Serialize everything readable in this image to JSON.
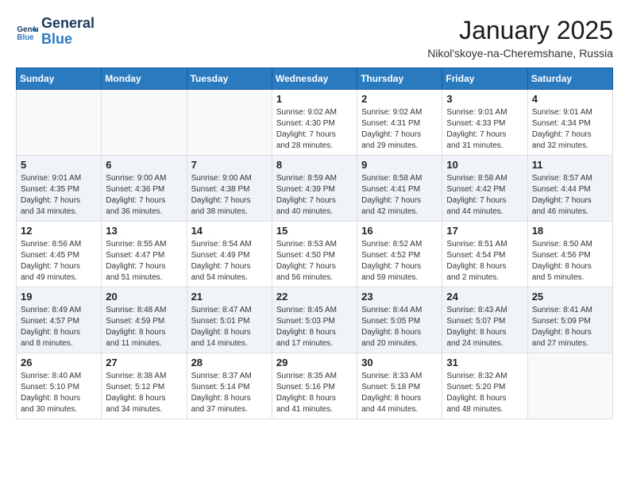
{
  "header": {
    "logo_line1": "General",
    "logo_line2": "Blue",
    "month_title": "January 2025",
    "location": "Nikol'skoye-na-Cheremshane, Russia"
  },
  "weekdays": [
    "Sunday",
    "Monday",
    "Tuesday",
    "Wednesday",
    "Thursday",
    "Friday",
    "Saturday"
  ],
  "weeks": [
    [
      {
        "day": "",
        "text": ""
      },
      {
        "day": "",
        "text": ""
      },
      {
        "day": "",
        "text": ""
      },
      {
        "day": "1",
        "text": "Sunrise: 9:02 AM\nSunset: 4:30 PM\nDaylight: 7 hours\nand 28 minutes."
      },
      {
        "day": "2",
        "text": "Sunrise: 9:02 AM\nSunset: 4:31 PM\nDaylight: 7 hours\nand 29 minutes."
      },
      {
        "day": "3",
        "text": "Sunrise: 9:01 AM\nSunset: 4:33 PM\nDaylight: 7 hours\nand 31 minutes."
      },
      {
        "day": "4",
        "text": "Sunrise: 9:01 AM\nSunset: 4:34 PM\nDaylight: 7 hours\nand 32 minutes."
      }
    ],
    [
      {
        "day": "5",
        "text": "Sunrise: 9:01 AM\nSunset: 4:35 PM\nDaylight: 7 hours\nand 34 minutes."
      },
      {
        "day": "6",
        "text": "Sunrise: 9:00 AM\nSunset: 4:36 PM\nDaylight: 7 hours\nand 36 minutes."
      },
      {
        "day": "7",
        "text": "Sunrise: 9:00 AM\nSunset: 4:38 PM\nDaylight: 7 hours\nand 38 minutes."
      },
      {
        "day": "8",
        "text": "Sunrise: 8:59 AM\nSunset: 4:39 PM\nDaylight: 7 hours\nand 40 minutes."
      },
      {
        "day": "9",
        "text": "Sunrise: 8:58 AM\nSunset: 4:41 PM\nDaylight: 7 hours\nand 42 minutes."
      },
      {
        "day": "10",
        "text": "Sunrise: 8:58 AM\nSunset: 4:42 PM\nDaylight: 7 hours\nand 44 minutes."
      },
      {
        "day": "11",
        "text": "Sunrise: 8:57 AM\nSunset: 4:44 PM\nDaylight: 7 hours\nand 46 minutes."
      }
    ],
    [
      {
        "day": "12",
        "text": "Sunrise: 8:56 AM\nSunset: 4:45 PM\nDaylight: 7 hours\nand 49 minutes."
      },
      {
        "day": "13",
        "text": "Sunrise: 8:55 AM\nSunset: 4:47 PM\nDaylight: 7 hours\nand 51 minutes."
      },
      {
        "day": "14",
        "text": "Sunrise: 8:54 AM\nSunset: 4:49 PM\nDaylight: 7 hours\nand 54 minutes."
      },
      {
        "day": "15",
        "text": "Sunrise: 8:53 AM\nSunset: 4:50 PM\nDaylight: 7 hours\nand 56 minutes."
      },
      {
        "day": "16",
        "text": "Sunrise: 8:52 AM\nSunset: 4:52 PM\nDaylight: 7 hours\nand 59 minutes."
      },
      {
        "day": "17",
        "text": "Sunrise: 8:51 AM\nSunset: 4:54 PM\nDaylight: 8 hours\nand 2 minutes."
      },
      {
        "day": "18",
        "text": "Sunrise: 8:50 AM\nSunset: 4:56 PM\nDaylight: 8 hours\nand 5 minutes."
      }
    ],
    [
      {
        "day": "19",
        "text": "Sunrise: 8:49 AM\nSunset: 4:57 PM\nDaylight: 8 hours\nand 8 minutes."
      },
      {
        "day": "20",
        "text": "Sunrise: 8:48 AM\nSunset: 4:59 PM\nDaylight: 8 hours\nand 11 minutes."
      },
      {
        "day": "21",
        "text": "Sunrise: 8:47 AM\nSunset: 5:01 PM\nDaylight: 8 hours\nand 14 minutes."
      },
      {
        "day": "22",
        "text": "Sunrise: 8:45 AM\nSunset: 5:03 PM\nDaylight: 8 hours\nand 17 minutes."
      },
      {
        "day": "23",
        "text": "Sunrise: 8:44 AM\nSunset: 5:05 PM\nDaylight: 8 hours\nand 20 minutes."
      },
      {
        "day": "24",
        "text": "Sunrise: 8:43 AM\nSunset: 5:07 PM\nDaylight: 8 hours\nand 24 minutes."
      },
      {
        "day": "25",
        "text": "Sunrise: 8:41 AM\nSunset: 5:09 PM\nDaylight: 8 hours\nand 27 minutes."
      }
    ],
    [
      {
        "day": "26",
        "text": "Sunrise: 8:40 AM\nSunset: 5:10 PM\nDaylight: 8 hours\nand 30 minutes."
      },
      {
        "day": "27",
        "text": "Sunrise: 8:38 AM\nSunset: 5:12 PM\nDaylight: 8 hours\nand 34 minutes."
      },
      {
        "day": "28",
        "text": "Sunrise: 8:37 AM\nSunset: 5:14 PM\nDaylight: 8 hours\nand 37 minutes."
      },
      {
        "day": "29",
        "text": "Sunrise: 8:35 AM\nSunset: 5:16 PM\nDaylight: 8 hours\nand 41 minutes."
      },
      {
        "day": "30",
        "text": "Sunrise: 8:33 AM\nSunset: 5:18 PM\nDaylight: 8 hours\nand 44 minutes."
      },
      {
        "day": "31",
        "text": "Sunrise: 8:32 AM\nSunset: 5:20 PM\nDaylight: 8 hours\nand 48 minutes."
      },
      {
        "day": "",
        "text": ""
      }
    ]
  ]
}
